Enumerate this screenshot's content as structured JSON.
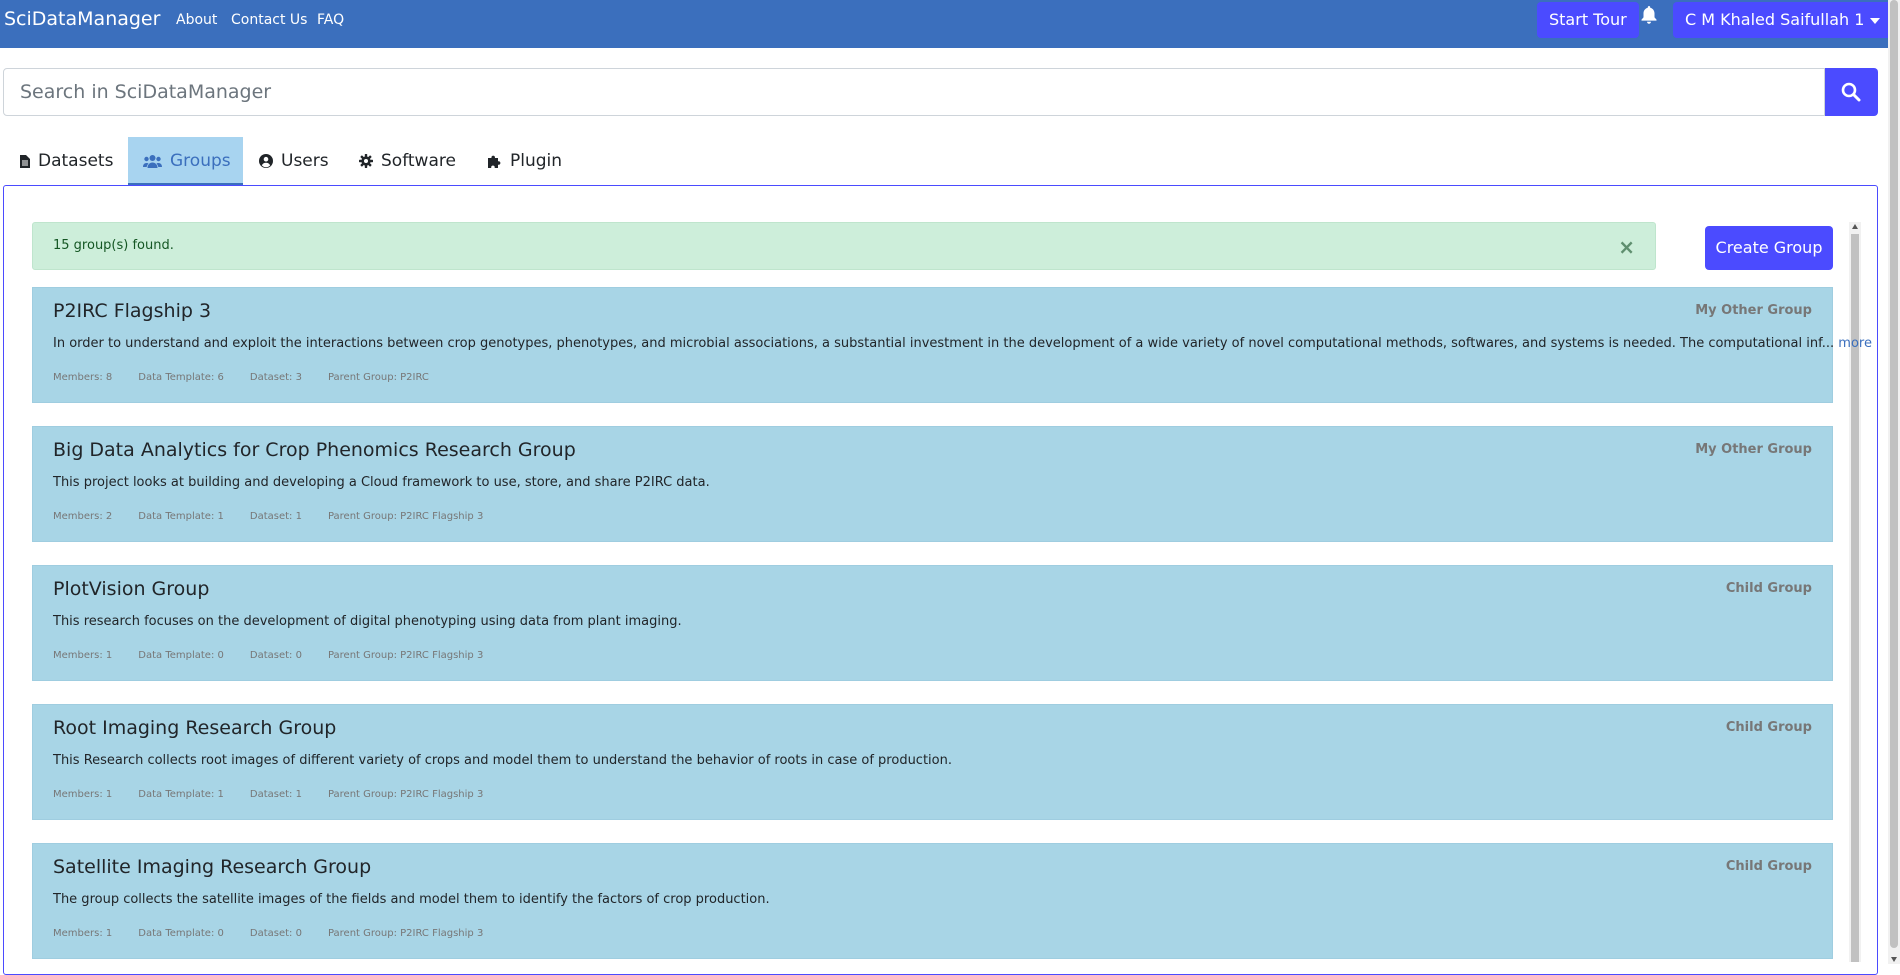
{
  "navbar": {
    "brand": "SciDataManager",
    "links": [
      "About",
      "Contact Us",
      "FAQ"
    ],
    "start_tour": "Start Tour",
    "user_name": "C M Khaled Saifullah 1"
  },
  "search": {
    "placeholder": "Search in SciDataManager",
    "value": ""
  },
  "tabs": [
    {
      "label": "Datasets",
      "icon": "file-icon",
      "active": false
    },
    {
      "label": "Groups",
      "icon": "users-icon",
      "active": true
    },
    {
      "label": "Users",
      "icon": "user-circle-icon",
      "active": false
    },
    {
      "label": "Software",
      "icon": "gear-icon",
      "active": false
    },
    {
      "label": "Plugin",
      "icon": "puzzle-icon",
      "active": false
    }
  ],
  "alert": {
    "text": "15 group(s) found.",
    "close": "×"
  },
  "create_group": "Create Group",
  "groups": [
    {
      "title": "P2IRC Flagship 3",
      "badge": "My Other Group",
      "description": "In order to understand and exploit the interactions between crop genotypes, phenotypes, and microbial associations, a substantial investment in the development of a wide variety of novel computational methods, softwares, and systems is needed. The computational inf...",
      "more": "more",
      "members": "Members: 8",
      "data_template": "Data Template: 6",
      "dataset": "Dataset: 3",
      "parent": "Parent Group: P2IRC"
    },
    {
      "title": "Big Data Analytics for Crop Phenomics Research Group",
      "badge": "My Other Group",
      "description": "This project looks at building and developing a Cloud framework to use, store, and share P2IRC data.",
      "more": "",
      "members": "Members: 2",
      "data_template": "Data Template: 1",
      "dataset": "Dataset: 1",
      "parent": "Parent Group: P2IRC Flagship 3"
    },
    {
      "title": "PlotVision Group",
      "badge": "Child Group",
      "description": "This research focuses on the development of digital phenotyping using data from plant imaging.",
      "more": "",
      "members": "Members: 1",
      "data_template": "Data Template: 0",
      "dataset": "Dataset: 0",
      "parent": "Parent Group: P2IRC Flagship 3"
    },
    {
      "title": "Root Imaging Research Group",
      "badge": "Child Group",
      "description": "This Research collects root images of different variety of crops and model them to understand the behavior of roots in case of production.",
      "more": "",
      "members": "Members: 1",
      "data_template": "Data Template: 1",
      "dataset": "Dataset: 1",
      "parent": "Parent Group: P2IRC Flagship 3"
    },
    {
      "title": "Satellite Imaging Research Group",
      "badge": "Child Group",
      "description": "The group collects the satellite images of the fields and model them to identify the factors of crop production.",
      "more": "",
      "members": "Members: 1",
      "data_template": "Data Template: 0",
      "dataset": "Dataset: 0",
      "parent": "Parent Group: P2IRC Flagship 3"
    }
  ],
  "colors": {
    "navbar": "#3b6fbd",
    "accent": "#4b4bff",
    "card": "#a8d5e6",
    "alert": "#cdeeda"
  }
}
